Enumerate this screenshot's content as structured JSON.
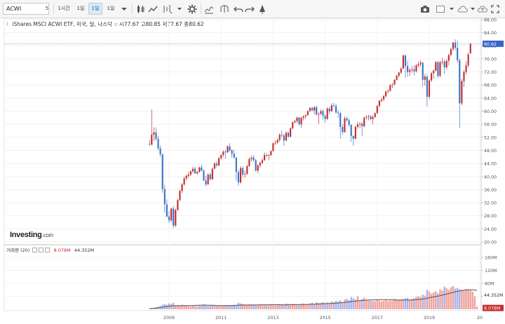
{
  "toolbar": {
    "symbol": "ACWI",
    "symbol_caret": "5",
    "interval_1h": "1시간",
    "interval_1d": "1일",
    "interval_1w": "1일",
    "interval_1m": "1일"
  },
  "legend": {
    "name": "iShares MSCI ACWI ETF, 미국, 달, 나스닥",
    "open_label": "시",
    "open": "77.67",
    "high_label": "고",
    "high": "80.85",
    "low_label": "저",
    "low": "77.67",
    "close_label": "종",
    "close": "80.62"
  },
  "volume_legend": {
    "label": "거래량 (20)",
    "value1": "8.078M",
    "value2": "44.352M"
  },
  "logo": {
    "brand": "Investing",
    "suffix": ".com"
  },
  "colors": {
    "up": "#3d74c9",
    "down": "#c62e2e",
    "vol_up": "#a9b4ec",
    "vol_down": "#f0a39e",
    "ma": "#555555",
    "price_label_bg": "#3366cc",
    "volume_label_bg": "#c62e2e"
  },
  "chart_data": [
    {
      "type": "candlestick",
      "interval": "month",
      "y_axis_side": "right",
      "ylim": [
        20,
        88
      ],
      "y_ticks": [
        "88.00",
        "84.00",
        "80.00",
        "76.00",
        "72.00",
        "68.00",
        "64.00",
        "60.00",
        "56.00",
        "52.00",
        "48.00",
        "44.00",
        "40.00",
        "36.00",
        "32.00",
        "28.00",
        "24.00",
        "20.00"
      ],
      "x_ticks": [
        "2009",
        "2011",
        "2013",
        "2015",
        "2017",
        "2019",
        "20"
      ],
      "last_price": "80.62",
      "points": [
        [
          "2008-04",
          50.0,
          51.2,
          49.4,
          49.8
        ],
        [
          "2008-05",
          49.8,
          60.5,
          49.5,
          52.8
        ],
        [
          "2008-06",
          52.8,
          55.1,
          50.8,
          53.5
        ],
        [
          "2008-07",
          53.5,
          55.0,
          51.0,
          51.5
        ],
        [
          "2008-08",
          51.5,
          52.5,
          48.0,
          48.6
        ],
        [
          "2008-09",
          48.6,
          49.5,
          46.0,
          46.8
        ],
        [
          "2008-10",
          46.8,
          47.0,
          35.0,
          36.2
        ],
        [
          "2008-11",
          36.2,
          37.5,
          29.0,
          31.5
        ],
        [
          "2008-12",
          31.5,
          33.0,
          27.5,
          27.8
        ],
        [
          "2009-01",
          27.8,
          29.5,
          25.8,
          26.6
        ],
        [
          "2009-02",
          26.6,
          30.5,
          26.0,
          30.2
        ],
        [
          "2009-03",
          30.2,
          31.0,
          24.2,
          25.0
        ],
        [
          "2009-04",
          25.0,
          30.2,
          24.6,
          29.8
        ],
        [
          "2009-05",
          29.8,
          33.2,
          29.5,
          32.8
        ],
        [
          "2009-06",
          32.8,
          36.0,
          32.5,
          35.6
        ],
        [
          "2009-07",
          35.6,
          38.0,
          35.0,
          37.6
        ],
        [
          "2009-08",
          37.6,
          40.0,
          37.2,
          39.4
        ],
        [
          "2009-09",
          39.4,
          40.6,
          38.8,
          40.2
        ],
        [
          "2009-10",
          40.2,
          41.5,
          39.5,
          40.6
        ],
        [
          "2009-11",
          40.6,
          42.0,
          40.2,
          41.6
        ],
        [
          "2009-12",
          41.6,
          43.0,
          41.0,
          42.4
        ],
        [
          "2010-01",
          42.4,
          43.0,
          40.8,
          41.0
        ],
        [
          "2010-02",
          41.0,
          41.8,
          40.5,
          41.4
        ],
        [
          "2010-03",
          41.4,
          43.0,
          41.2,
          42.8
        ],
        [
          "2010-04",
          42.8,
          43.6,
          41.6,
          41.8
        ],
        [
          "2010-05",
          41.8,
          42.2,
          38.6,
          38.8
        ],
        [
          "2010-06",
          38.8,
          40.2,
          37.0,
          37.6
        ],
        [
          "2010-07",
          37.6,
          41.0,
          37.5,
          40.6
        ],
        [
          "2010-08",
          40.6,
          41.2,
          38.8,
          39.2
        ],
        [
          "2010-09",
          39.2,
          42.8,
          39.0,
          42.4
        ],
        [
          "2010-10",
          42.4,
          44.4,
          42.2,
          44.0
        ],
        [
          "2010-11",
          44.0,
          44.8,
          42.8,
          43.4
        ],
        [
          "2010-12",
          43.4,
          46.0,
          43.2,
          45.6
        ],
        [
          "2011-01",
          45.6,
          46.8,
          45.2,
          46.6
        ],
        [
          "2011-02",
          46.6,
          48.0,
          46.0,
          47.6
        ],
        [
          "2011-03",
          47.6,
          48.2,
          45.4,
          47.4
        ],
        [
          "2011-04",
          47.4,
          49.6,
          47.2,
          49.2
        ],
        [
          "2011-05",
          49.2,
          50.2,
          47.6,
          48.0
        ],
        [
          "2011-06",
          48.0,
          48.4,
          45.8,
          47.0
        ],
        [
          "2011-07",
          47.0,
          48.2,
          45.6,
          45.8
        ],
        [
          "2011-08",
          45.8,
          46.0,
          38.8,
          41.4
        ],
        [
          "2011-09",
          41.4,
          42.0,
          37.2,
          38.2
        ],
        [
          "2011-10",
          38.2,
          43.2,
          37.8,
          42.6
        ],
        [
          "2011-11",
          42.6,
          43.0,
          39.8,
          40.6
        ],
        [
          "2011-12",
          40.6,
          41.8,
          39.6,
          40.8
        ],
        [
          "2012-01",
          40.8,
          43.6,
          40.6,
          43.2
        ],
        [
          "2012-02",
          43.2,
          45.8,
          43.0,
          45.4
        ],
        [
          "2012-03",
          45.4,
          46.4,
          44.6,
          45.8
        ],
        [
          "2012-04",
          45.8,
          46.6,
          44.6,
          45.0
        ],
        [
          "2012-05",
          45.0,
          45.4,
          41.6,
          41.8
        ],
        [
          "2012-06",
          41.8,
          43.8,
          41.0,
          43.4
        ],
        [
          "2012-07",
          43.4,
          44.6,
          42.6,
          44.2
        ],
        [
          "2012-08",
          44.2,
          45.6,
          43.8,
          45.0
        ],
        [
          "2012-09",
          45.0,
          47.4,
          44.8,
          46.6
        ],
        [
          "2012-10",
          46.6,
          47.2,
          45.8,
          46.4
        ],
        [
          "2012-11",
          46.4,
          46.8,
          45.0,
          46.6
        ],
        [
          "2012-12",
          46.6,
          48.0,
          46.2,
          47.8
        ],
        [
          "2013-01",
          47.8,
          50.4,
          47.6,
          50.2
        ],
        [
          "2013-02",
          50.2,
          51.0,
          49.6,
          50.4
        ],
        [
          "2013-03",
          50.4,
          51.6,
          50.0,
          51.2
        ],
        [
          "2013-04",
          51.2,
          53.2,
          50.6,
          52.8
        ],
        [
          "2013-05",
          52.8,
          54.2,
          52.0,
          52.6
        ],
        [
          "2013-06",
          52.6,
          53.0,
          49.4,
          51.0
        ],
        [
          "2013-07",
          51.0,
          53.8,
          50.8,
          53.4
        ],
        [
          "2013-08",
          53.4,
          53.8,
          51.8,
          52.2
        ],
        [
          "2013-09",
          52.2,
          55.0,
          52.0,
          54.8
        ],
        [
          "2013-10",
          54.8,
          56.8,
          54.4,
          56.6
        ],
        [
          "2013-11",
          56.6,
          57.4,
          56.2,
          57.0
        ],
        [
          "2013-12",
          57.0,
          58.4,
          56.4,
          58.0
        ],
        [
          "2014-01",
          58.0,
          58.4,
          55.6,
          56.0
        ],
        [
          "2014-02",
          56.0,
          58.2,
          55.0,
          58.0
        ],
        [
          "2014-03",
          58.0,
          58.8,
          57.2,
          58.4
        ],
        [
          "2014-04",
          58.4,
          59.0,
          57.6,
          58.8
        ],
        [
          "2014-05",
          58.8,
          60.2,
          58.6,
          60.0
        ],
        [
          "2014-06",
          60.0,
          61.2,
          59.8,
          61.0
        ],
        [
          "2014-07",
          61.0,
          61.4,
          60.0,
          60.2
        ],
        [
          "2014-08",
          60.2,
          61.6,
          59.0,
          61.2
        ],
        [
          "2014-09",
          61.2,
          61.8,
          58.6,
          59.0
        ],
        [
          "2014-10",
          59.0,
          59.6,
          56.0,
          59.2
        ],
        [
          "2014-11",
          59.2,
          60.6,
          58.8,
          60.0
        ],
        [
          "2014-12",
          60.0,
          60.6,
          57.4,
          58.6
        ],
        [
          "2015-01",
          58.6,
          59.0,
          56.4,
          57.6
        ],
        [
          "2015-02",
          57.6,
          61.2,
          57.4,
          60.8
        ],
        [
          "2015-03",
          60.8,
          61.4,
          59.2,
          60.0
        ],
        [
          "2015-04",
          60.0,
          62.4,
          59.8,
          61.8
        ],
        [
          "2015-05",
          61.8,
          62.6,
          61.2,
          61.6
        ],
        [
          "2015-06",
          61.6,
          62.2,
          59.2,
          59.6
        ],
        [
          "2015-07",
          59.6,
          60.4,
          58.0,
          59.4
        ],
        [
          "2015-08",
          59.4,
          59.8,
          51.6,
          55.2
        ],
        [
          "2015-09",
          55.2,
          56.0,
          52.8,
          53.6
        ],
        [
          "2015-10",
          53.6,
          58.4,
          53.4,
          57.8
        ],
        [
          "2015-11",
          57.8,
          58.4,
          56.8,
          57.2
        ],
        [
          "2015-12",
          57.2,
          57.8,
          55.2,
          55.8
        ],
        [
          "2016-01",
          55.8,
          56.0,
          50.6,
          52.4
        ],
        [
          "2016-02",
          52.4,
          52.6,
          49.4,
          51.6
        ],
        [
          "2016-03",
          51.6,
          55.6,
          51.4,
          55.2
        ],
        [
          "2016-04",
          55.2,
          56.8,
          54.6,
          56.0
        ],
        [
          "2016-05",
          56.0,
          56.6,
          54.8,
          56.2
        ],
        [
          "2016-06",
          56.2,
          56.8,
          52.4,
          55.4
        ],
        [
          "2016-07",
          55.4,
          58.4,
          55.0,
          58.0
        ],
        [
          "2016-08",
          58.0,
          58.8,
          57.4,
          58.2
        ],
        [
          "2016-09",
          58.2,
          59.0,
          57.2,
          58.4
        ],
        [
          "2016-10",
          58.4,
          58.8,
          57.2,
          57.6
        ],
        [
          "2016-11",
          57.6,
          58.8,
          56.0,
          58.2
        ],
        [
          "2016-12",
          58.2,
          59.6,
          58.0,
          59.4
        ],
        [
          "2017-01",
          59.4,
          61.8,
          59.2,
          61.6
        ],
        [
          "2017-02",
          61.6,
          63.4,
          61.2,
          63.2
        ],
        [
          "2017-03",
          63.2,
          64.2,
          62.6,
          63.6
        ],
        [
          "2017-04",
          63.6,
          65.0,
          63.0,
          64.6
        ],
        [
          "2017-05",
          64.6,
          66.4,
          64.2,
          66.0
        ],
        [
          "2017-06",
          66.0,
          66.8,
          65.4,
          66.2
        ],
        [
          "2017-07",
          66.2,
          68.2,
          66.0,
          68.0
        ],
        [
          "2017-08",
          68.0,
          68.6,
          67.0,
          68.2
        ],
        [
          "2017-09",
          68.2,
          69.8,
          67.8,
          69.6
        ],
        [
          "2017-10",
          69.6,
          71.2,
          69.4,
          70.8
        ],
        [
          "2017-11",
          70.8,
          72.0,
          70.4,
          71.8
        ],
        [
          "2017-12",
          71.8,
          73.4,
          71.4,
          73.0
        ],
        [
          "2018-01",
          73.0,
          77.4,
          73.0,
          77.0
        ],
        [
          "2018-02",
          77.0,
          77.4,
          70.2,
          73.8
        ],
        [
          "2018-03",
          73.8,
          75.4,
          70.6,
          72.0
        ],
        [
          "2018-04",
          72.0,
          73.2,
          70.8,
          72.6
        ],
        [
          "2018-05",
          72.6,
          73.8,
          71.8,
          72.8
        ],
        [
          "2018-06",
          72.8,
          74.0,
          71.0,
          72.2
        ],
        [
          "2018-07",
          72.2,
          74.4,
          71.8,
          74.0
        ],
        [
          "2018-08",
          74.0,
          75.2,
          73.4,
          74.4
        ],
        [
          "2018-09",
          74.4,
          75.6,
          73.6,
          74.8
        ],
        [
          "2018-10",
          74.8,
          75.2,
          67.6,
          69.6
        ],
        [
          "2018-11",
          69.6,
          71.4,
          67.8,
          70.6
        ],
        [
          "2018-12",
          70.6,
          71.4,
          61.4,
          64.4
        ],
        [
          "2019-01",
          64.4,
          69.8,
          63.8,
          69.4
        ],
        [
          "2019-02",
          69.4,
          72.0,
          69.0,
          71.6
        ],
        [
          "2019-03",
          71.6,
          72.8,
          70.0,
          72.4
        ],
        [
          "2019-04",
          72.4,
          75.4,
          72.2,
          75.0
        ],
        [
          "2019-05",
          75.0,
          75.4,
          70.2,
          70.8
        ],
        [
          "2019-06",
          70.8,
          75.4,
          70.4,
          75.0
        ],
        [
          "2019-07",
          75.0,
          76.4,
          74.2,
          75.2
        ],
        [
          "2019-08",
          75.2,
          75.8,
          71.4,
          73.4
        ],
        [
          "2019-09",
          73.4,
          75.8,
          72.8,
          75.4
        ],
        [
          "2019-10",
          75.4,
          77.6,
          74.0,
          77.2
        ],
        [
          "2019-11",
          77.2,
          79.4,
          76.8,
          79.0
        ],
        [
          "2019-12",
          79.0,
          81.2,
          78.4,
          81.0
        ],
        [
          "2020-01",
          81.0,
          82.0,
          78.6,
          79.4
        ],
        [
          "2020-02",
          79.4,
          81.6,
          74.8,
          75.6
        ],
        [
          "2020-03",
          75.6,
          76.0,
          54.8,
          62.4
        ],
        [
          "2020-04",
          62.4,
          69.8,
          61.8,
          69.2
        ],
        [
          "2020-05",
          69.2,
          72.6,
          67.4,
          72.0
        ],
        [
          "2020-06",
          72.0,
          75.4,
          71.2,
          74.0
        ],
        [
          "2020-07",
          74.0,
          77.8,
          73.4,
          77.4
        ],
        [
          "2020-08",
          77.67,
          80.85,
          77.67,
          80.62
        ]
      ]
    },
    {
      "type": "bar",
      "title": "거래량 (20)",
      "ylim": [
        0,
        195
      ],
      "y_ticks": [
        "160M",
        "120M",
        "80M",
        "40M"
      ],
      "y_ticks_values": [
        160,
        120,
        80,
        40
      ],
      "last_volume": "8.078M",
      "last_ma": "44.352M",
      "values": [
        2,
        3,
        4,
        6,
        8,
        10,
        14,
        16,
        14,
        18,
        16,
        20,
        12,
        12,
        11,
        14,
        13,
        12,
        10,
        9,
        11,
        10,
        9,
        12,
        12,
        15,
        13,
        10,
        12,
        13,
        11,
        10,
        11,
        12,
        11,
        13,
        12,
        12,
        13,
        14,
        14,
        20,
        18,
        16,
        14,
        12,
        15,
        13,
        13,
        12,
        14,
        15,
        14,
        13,
        12,
        12,
        15,
        13,
        12,
        14,
        16,
        15,
        14,
        18,
        16,
        14,
        17,
        16,
        14,
        15,
        16,
        18,
        14,
        16,
        18,
        20,
        17,
        22,
        19,
        20,
        22,
        19,
        21,
        20,
        24,
        22,
        26,
        24,
        28,
        22,
        30,
        32,
        28,
        38,
        34,
        30,
        40,
        28,
        32,
        36,
        30,
        28,
        26,
        26,
        25,
        28,
        27,
        24,
        26,
        28,
        25,
        27,
        26,
        32,
        30,
        28,
        30,
        32,
        34,
        35,
        30,
        32,
        34,
        38,
        40,
        38,
        45,
        42,
        60,
        55,
        48,
        52,
        56,
        50,
        62,
        58,
        70,
        65,
        60,
        68,
        72,
        64,
        66,
        62,
        60,
        58,
        62,
        60,
        58,
        55,
        40,
        8
      ]
    }
  ]
}
